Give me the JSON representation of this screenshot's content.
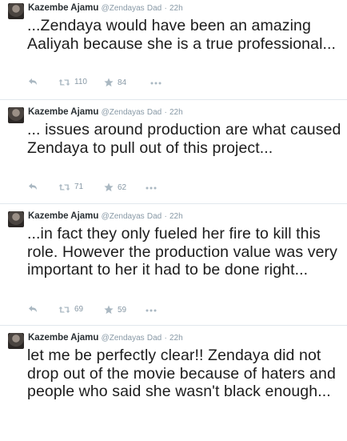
{
  "tweets": [
    {
      "name": "Kazembe Ajamu",
      "handle": "@Zendayas",
      "tag": "Dad",
      "separator": "·",
      "time": "22h",
      "text": "...Zendaya would have been an amazing Aaliyah because she is a true professional...",
      "retweets": "110",
      "favorites": "84"
    },
    {
      "name": "Kazembe Ajamu",
      "handle": "@Zendayas",
      "tag": "Dad",
      "separator": "·",
      "time": "22h",
      "text": "... issues around production are what caused Zendaya to pull out of this project...",
      "retweets": "71",
      "favorites": "62"
    },
    {
      "name": "Kazembe Ajamu",
      "handle": "@Zendayas",
      "tag": "Dad",
      "separator": "·",
      "time": "22h",
      "text": "...in fact they only fueled her fire to kill this role. However the production value was very important to her it had to be done right...",
      "retweets": "69",
      "favorites": "59"
    },
    {
      "name": "Kazembe Ajamu",
      "handle": "@Zendayas",
      "tag": "Dad",
      "separator": "·",
      "time": "22h",
      "text": "let me be perfectly clear!! Zendaya did not drop out of the movie because of haters and people who said she wasn't black enough..."
    }
  ],
  "icons": {
    "reply": "reply-icon",
    "retweet": "retweet-icon",
    "favorite": "star-icon",
    "more": "more-icon"
  },
  "colors": {
    "text": "#1c1c1c",
    "muted": "#8899a6",
    "divider": "#e1e8ed"
  }
}
